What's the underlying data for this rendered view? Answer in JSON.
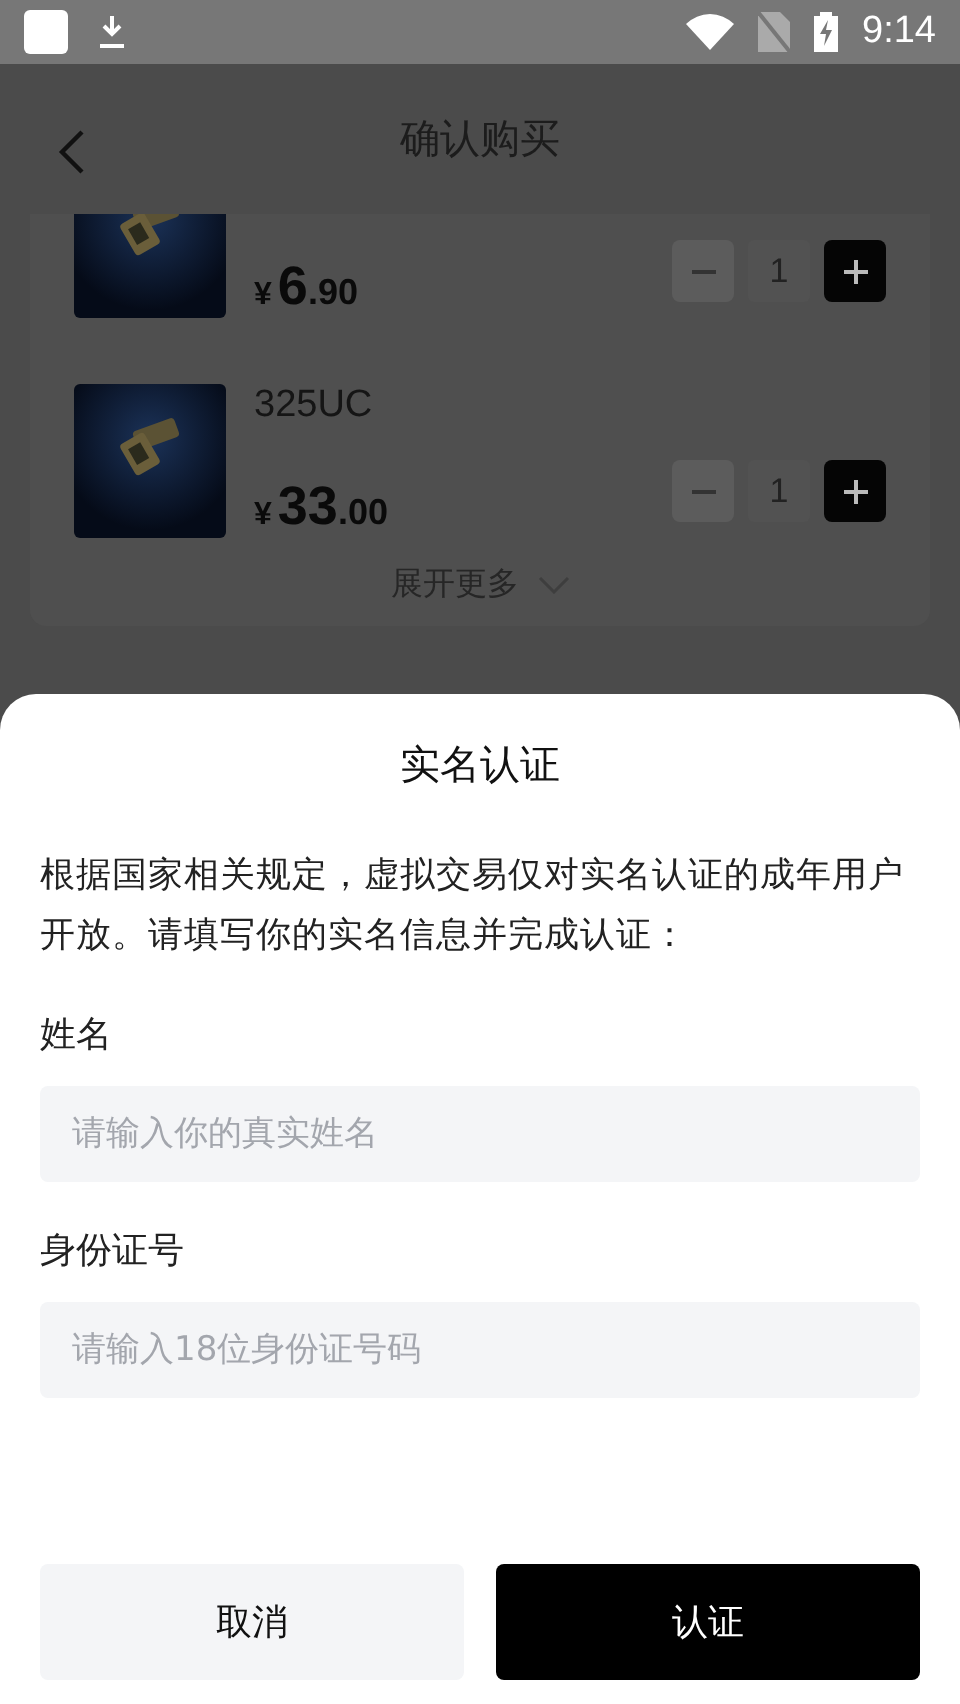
{
  "status_bar": {
    "time": "9:14"
  },
  "header": {
    "title": "确认购买"
  },
  "products": [
    {
      "currency": "¥",
      "price_whole": "6",
      "price_fraction": ".90",
      "quantity": "1"
    },
    {
      "name": "325UC",
      "currency": "¥",
      "price_whole": "33",
      "price_fraction": ".00",
      "quantity": "1"
    }
  ],
  "expand_link": "展开更多",
  "dialog": {
    "title": "实名认证",
    "message": "根据国家相关规定，虚拟交易仅对实名认证的成年用户开放。请填写你的实名信息并完成认证：",
    "fields": [
      {
        "label": "姓名",
        "placeholder": "请输入你的真实姓名"
      },
      {
        "label": "身份证号",
        "placeholder": "请输入18位身份证号码"
      }
    ],
    "buttons": [
      {
        "kind": "secondary",
        "label": "取消"
      },
      {
        "kind": "primary",
        "label": "认证"
      }
    ]
  }
}
